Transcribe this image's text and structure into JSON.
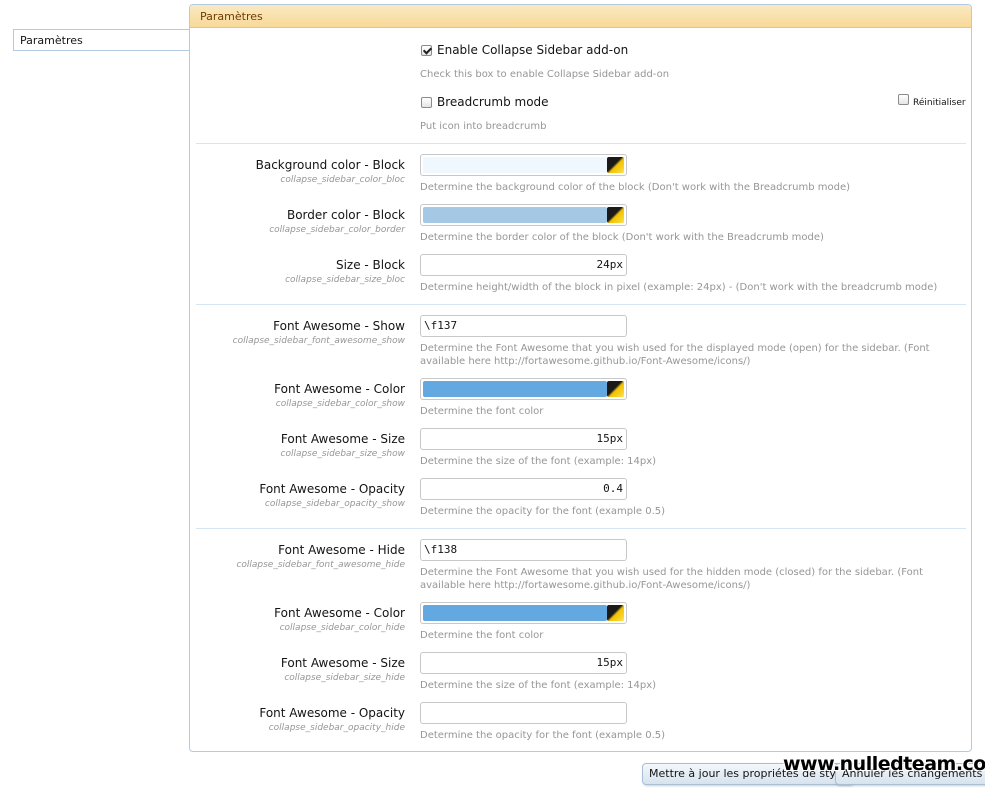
{
  "tab": {
    "label": "Paramètres"
  },
  "panel": {
    "title": "Paramètres"
  },
  "options": {
    "enable": {
      "label": "Enable Collapse Sidebar add-on",
      "hint": "Check this box to enable Collapse Sidebar add-on",
      "checked": true
    },
    "breadcrumb": {
      "label": "Breadcrumb mode",
      "hint": "Put icon into breadcrumb",
      "checked": false
    },
    "reset": {
      "label": "Réinitialiser",
      "checked": false
    }
  },
  "fields": {
    "bg_color": {
      "label": "Background color - Block",
      "key": "collapse_sidebar_color_bloc",
      "hint": "Determine the background color of the block (Don't work with the Breadcrumb mode)",
      "color": "#f0f8ff"
    },
    "border_color": {
      "label": "Border color - Block",
      "key": "collapse_sidebar_color_border",
      "hint": "Determine the border color of the block (Don't work with the Breadcrumb mode)",
      "color": "#a5c8e4"
    },
    "size_block": {
      "label": "Size - Block",
      "key": "collapse_sidebar_size_bloc",
      "hint": "Determine height/width of the block in pixel (example: 24px) - (Don't work with the breadcrumb mode)",
      "value": "24px"
    },
    "fa_show": {
      "label": "Font Awesome - Show",
      "key": "collapse_sidebar_font_awesome_show",
      "hint": "Determine the Font Awesome that you wish used for the displayed mode (open) for the sidebar. (Font available here http://fortawesome.github.io/Font-Awesome/icons/)",
      "value": "\\f137"
    },
    "fa_color_show": {
      "label": "Font Awesome - Color",
      "key": "collapse_sidebar_color_show",
      "hint": "Determine the font color",
      "color": "#63a8e0"
    },
    "fa_size_show": {
      "label": "Font Awesome - Size",
      "key": "collapse_sidebar_size_show",
      "hint": "Determine the size of the font (example: 14px)",
      "value": "15px"
    },
    "fa_opacity_show": {
      "label": "Font Awesome - Opacity",
      "key": "collapse_sidebar_opacity_show",
      "hint": "Determine the opacity for the font (example 0.5)",
      "value": "0.4"
    },
    "fa_hide": {
      "label": "Font Awesome - Hide",
      "key": "collapse_sidebar_font_awesome_hide",
      "hint": "Determine the Font Awesome that you wish used for the hidden mode (closed) for the sidebar. (Font available here http://fortawesome.github.io/Font-Awesome/icons/)",
      "value": "\\f138"
    },
    "fa_color_hide": {
      "label": "Font Awesome - Color",
      "key": "collapse_sidebar_color_hide",
      "hint": "Determine the font color",
      "color": "#63a8e0"
    },
    "fa_size_hide": {
      "label": "Font Awesome - Size",
      "key": "collapse_sidebar_size_hide",
      "hint": "Determine the size of the font (example: 14px)",
      "value": "15px"
    },
    "fa_opacity_hide": {
      "label": "Font Awesome - Opacity",
      "key": "collapse_sidebar_opacity_hide",
      "hint": "Determine the opacity for the font (example 0.5)",
      "value": ""
    }
  },
  "buttons": {
    "save": "Mettre à jour les propriétés de style",
    "cancel": "Annuler les changements"
  },
  "watermark": "www.nulledteam.com"
}
